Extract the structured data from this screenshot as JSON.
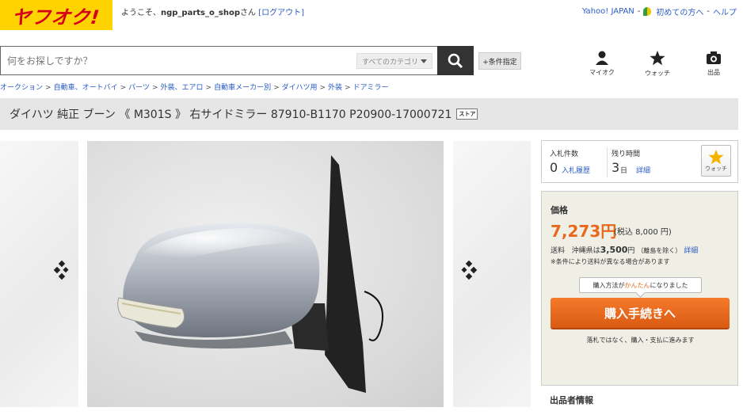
{
  "header": {
    "logo_text": "ヤフオク!",
    "welcome_prefix": "ようこそ、",
    "username": "ngp_parts_o_shop",
    "welcome_suffix": "さん",
    "logout_label": "[ログアウト]",
    "links": [
      "Yahoo! JAPAN",
      "初めての方へ",
      "ヘルプ"
    ]
  },
  "search": {
    "placeholder": "何をお探しですか？",
    "category_label": "すべてのカテゴリ",
    "condition_label": "+条件指定"
  },
  "nav_icons": [
    {
      "label": "マイオク",
      "icon": "user-icon"
    },
    {
      "label": "ウォッチ",
      "icon": "star-icon"
    },
    {
      "label": "出品",
      "icon": "camera-icon"
    }
  ],
  "breadcrumb": [
    "オークション",
    "自動車、オートバイ",
    "パーツ",
    "外装、エアロ",
    "自動車メーカー別",
    "ダイハツ用",
    "外装",
    "ドアミラー"
  ],
  "title": {
    "text": "ダイハツ 純正 ブーン 《 M301S 》 右サイドミラー 87910-B1170 P20900-17000721",
    "badge": "ストア"
  },
  "bids": {
    "count_label": "入札件数",
    "count_value": "0",
    "history_link": "入札履歴",
    "time_label": "残り時間",
    "time_value": "3",
    "time_unit": "日",
    "detail_link": "詳細",
    "watch_label": "ウォッチ"
  },
  "price": {
    "label": "価格",
    "value": "7,273円",
    "tax_text": "(税込 8,000 円)",
    "ship_label": "送料",
    "ship_region": "沖縄県は",
    "ship_amount": "3,500",
    "ship_unit": "円",
    "ship_note": "（離島を除く）",
    "ship_detail_link": "詳細",
    "ship_caution": "※条件により送料が異なる場合があります",
    "tip_prefix": "購入方法が",
    "tip_emphasis": "かんたん",
    "tip_suffix": "になりました",
    "buy_button": "購入手続きへ",
    "buy_note": "落札ではなく、購入・支払に進みます"
  },
  "seller": {
    "header": "出品者情報"
  },
  "colors": {
    "brand_yellow": "#ffd300",
    "brand_red": "#d5001c",
    "accent_orange": "#e8691e",
    "link_blue": "#2a5bc6"
  }
}
